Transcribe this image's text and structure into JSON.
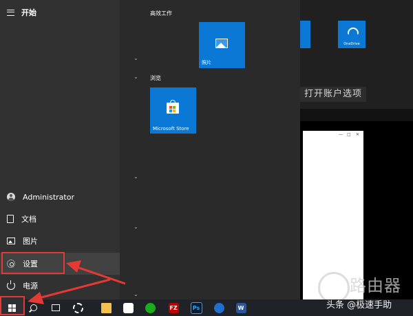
{
  "start_menu": {
    "title": "开始",
    "user_name": "Administrator",
    "documents": "文档",
    "pictures": "图片",
    "settings": "设置",
    "power": "电源"
  },
  "groups": {
    "productivity": "高效工作",
    "explore": "浏览"
  },
  "tiles": {
    "photos": "照片",
    "store": "Microsoft Store"
  },
  "background": {
    "account_options_text": "打开账户选项",
    "cloud_tile_label": "OneDrive",
    "watermark": "路由器",
    "watermark_bottom": "头条 @极速手助"
  },
  "taskbar": {
    "filezilla": "FZ",
    "photoshop": "Ps",
    "word": "W"
  },
  "colors": {
    "tile_blue": "#0a78d4",
    "highlight_red": "#e53935"
  }
}
